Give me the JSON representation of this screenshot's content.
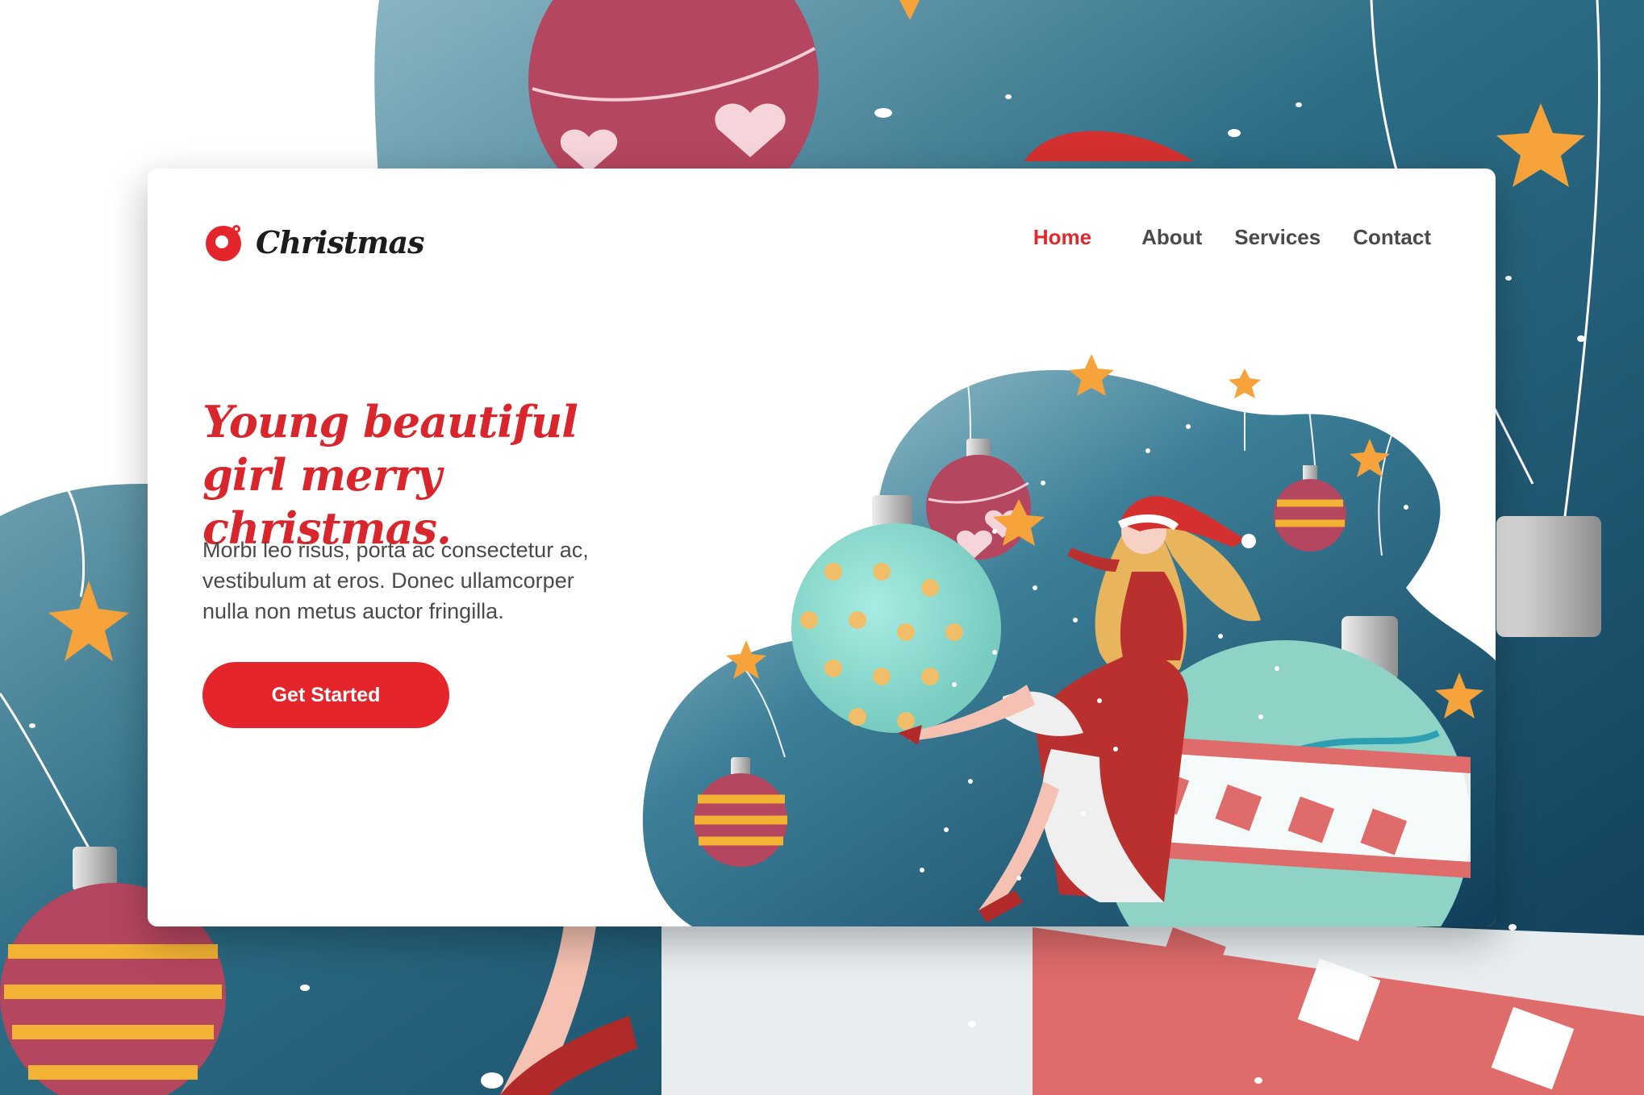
{
  "brand": {
    "name": "Christmas"
  },
  "nav": {
    "items": [
      {
        "label": "Home",
        "active": true
      },
      {
        "label": "About",
        "active": false
      },
      {
        "label": "Services",
        "active": false
      },
      {
        "label": "Contact",
        "active": false
      }
    ]
  },
  "hero": {
    "headline_line1": "Young beautiful",
    "headline_line2": "girl merry christmas.",
    "description_line1": "Morbi leo risus, porta ac consectetur ac,",
    "description_line2": "vestibulum at eros. Donec ullamcorper",
    "description_line3": "nulla non metus auctor fringilla.",
    "cta_label": "Get Started"
  },
  "colors": {
    "accent": "#e4262c",
    "text": "#4a4a4a",
    "teal_dark": "#1b4f6b",
    "teal_light": "#8fbfca"
  }
}
